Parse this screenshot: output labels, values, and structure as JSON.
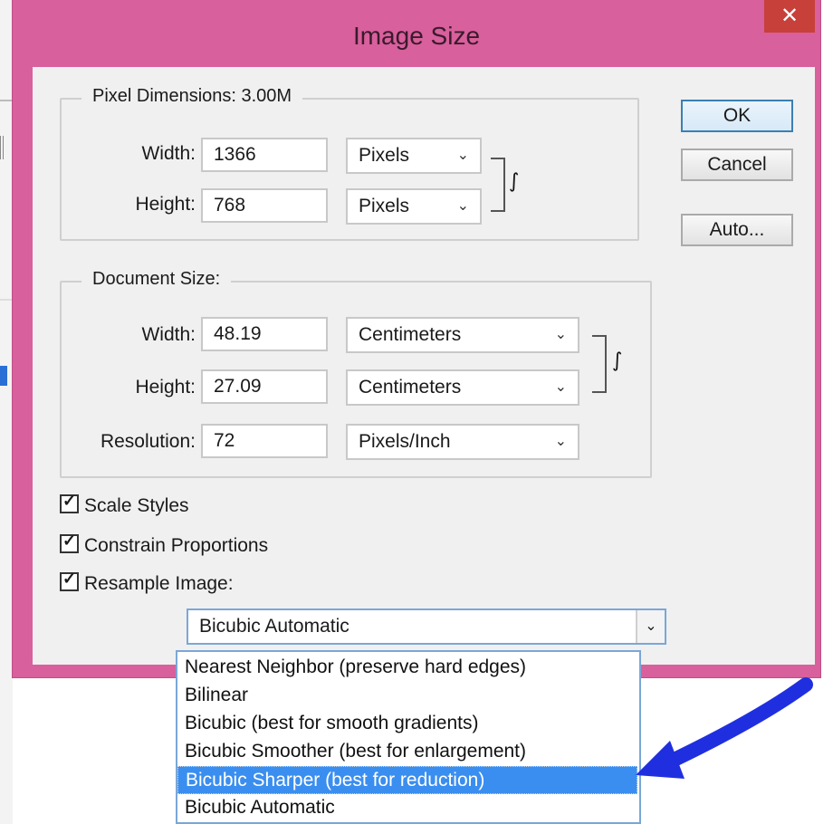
{
  "dialog": {
    "title": "Image Size",
    "close_label": "✕"
  },
  "pixel_dimensions": {
    "legend": "Pixel Dimensions:  3.00M",
    "width_label": "Width:",
    "width_value": "1366",
    "width_unit": "Pixels",
    "height_label": "Height:",
    "height_value": "768",
    "height_unit": "Pixels"
  },
  "document_size": {
    "legend": "Document Size:",
    "width_label": "Width:",
    "width_value": "48.19",
    "width_unit": "Centimeters",
    "height_label": "Height:",
    "height_value": "27.09",
    "height_unit": "Centimeters",
    "resolution_label": "Resolution:",
    "resolution_value": "72",
    "resolution_unit": "Pixels/Inch"
  },
  "buttons": {
    "ok": "OK",
    "cancel": "Cancel",
    "auto": "Auto..."
  },
  "checkboxes": {
    "scale_styles": {
      "label": "Scale Styles",
      "checked": true
    },
    "constrain": {
      "label": "Constrain Proportions",
      "checked": true
    },
    "resample": {
      "label": "Resample Image:",
      "checked": true
    }
  },
  "resample": {
    "selected": "Bicubic Automatic",
    "options": [
      "Nearest Neighbor (preserve hard edges)",
      "Bilinear",
      "Bicubic (best for smooth gradients)",
      "Bicubic Smoother (best for enlargement)",
      "Bicubic Sharper (best for reduction)",
      "Bicubic Automatic"
    ],
    "highlighted_index": 4
  },
  "icons": {
    "chevron": "chevron-down-icon",
    "link": "chain-link-icon",
    "check": "checkmark-icon",
    "arrow": "pointer-arrow-icon"
  },
  "colors": {
    "titlebar": "#d8609c",
    "close": "#c8403a",
    "highlight": "#3a8ef0",
    "arrow": "#1f2fe0"
  }
}
